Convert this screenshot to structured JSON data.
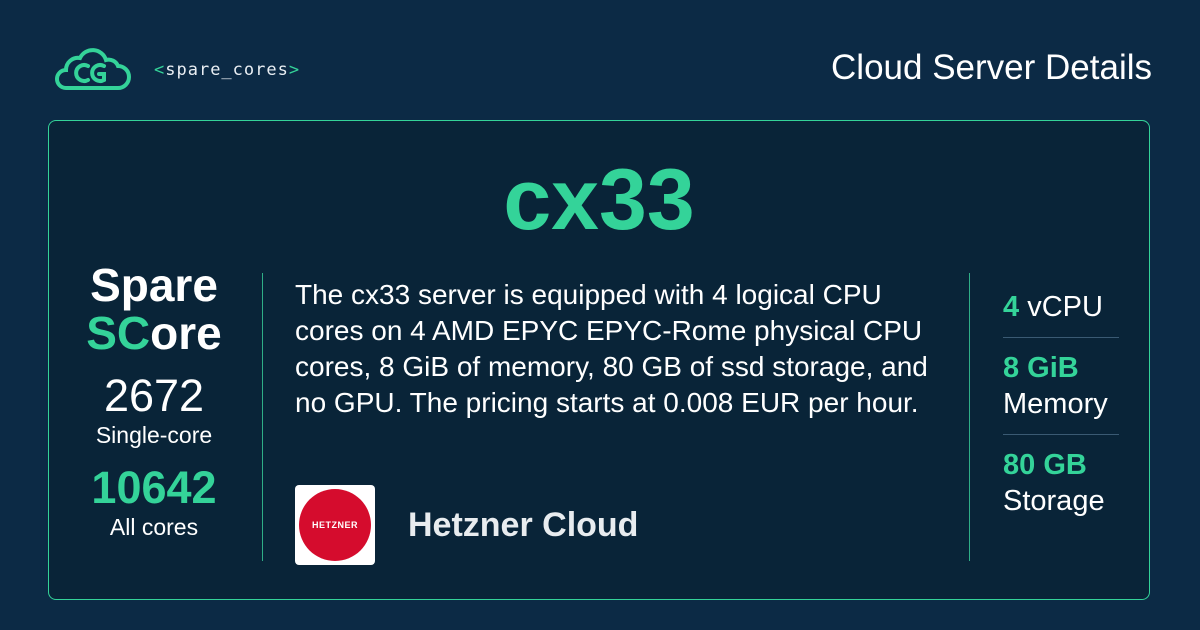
{
  "header": {
    "logo_text": "spare_cores",
    "logo_bracket_open": "<",
    "logo_bracket_close": ">",
    "title": "Cloud Server Details"
  },
  "server": {
    "name": "cx33",
    "description": "The cx33 server is equipped with 4 logical CPU cores on 4 AMD EPYC EPYC-Rome physical CPU cores, 8 GiB of memory, 80 GB of ssd storage, and no GPU. The pricing starts at 0.008 EUR per hour."
  },
  "score": {
    "brand_line1": "Spare",
    "brand_sc": "SC",
    "brand_ore": "ore",
    "single_value": "2672",
    "single_label": "Single-core",
    "multi_value": "10642",
    "multi_label": "All cores"
  },
  "vendor": {
    "logo_text": "HETZNER",
    "name": "Hetzner Cloud"
  },
  "specs": {
    "vcpu_value": "4",
    "vcpu_label": "vCPU",
    "memory_value": "8 GiB",
    "memory_label": "Memory",
    "storage_value": "80 GB",
    "storage_label": "Storage"
  },
  "colors": {
    "background": "#0c2a45",
    "accent": "#34d399",
    "hetzner_red": "#d50c2d"
  },
  "icons": {
    "logo": "spare-cores-cloud-logo-icon"
  }
}
